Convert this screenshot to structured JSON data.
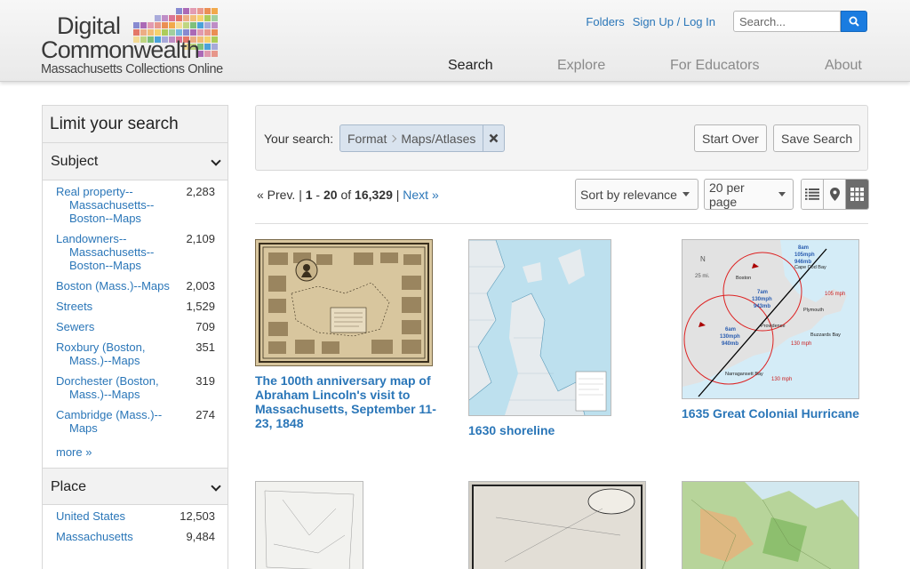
{
  "header": {
    "logo": {
      "line1": "Digital",
      "line2": "Commonwealth",
      "line3": "Massachusetts Collections Online"
    },
    "utility": {
      "folders": "Folders",
      "signup": "Sign Up / Log In",
      "search_placeholder": "Search..."
    },
    "nav": [
      {
        "label": "Search"
      },
      {
        "label": "Explore"
      },
      {
        "label": "For Educators"
      },
      {
        "label": "About"
      }
    ]
  },
  "sidebar": {
    "title": "Limit your search",
    "subject": {
      "heading": "Subject",
      "items": [
        {
          "label": "Real property--Massachusetts--Boston--Maps",
          "count": "2,283"
        },
        {
          "label": "Landowners--Massachusetts--Boston--Maps",
          "count": "2,109"
        },
        {
          "label": "Boston (Mass.)--Maps",
          "count": "2,003"
        },
        {
          "label": "Streets",
          "count": "1,529"
        },
        {
          "label": "Sewers",
          "count": "709"
        },
        {
          "label": "Roxbury (Boston, Mass.)--Maps",
          "count": "351"
        },
        {
          "label": "Dorchester (Boston, Mass.)--Maps",
          "count": "319"
        },
        {
          "label": "Cambridge (Mass.)--Maps",
          "count": "274"
        }
      ],
      "more": "more »"
    },
    "place": {
      "heading": "Place",
      "items": [
        {
          "label": "United States",
          "count": "12,503"
        },
        {
          "label": "Massachusetts",
          "count": "9,484"
        }
      ]
    }
  },
  "constraints": {
    "your_search": "Your search:",
    "filter_field": "Format",
    "filter_value": "Maps/Atlases",
    "start_over": "Start Over",
    "save_search": "Save Search"
  },
  "pager": {
    "prev": "« Prev.",
    "sep": "|",
    "start": "1",
    "dash": "-",
    "end": "20",
    "of": "of",
    "total": "16,329",
    "next": "Next »"
  },
  "sort": {
    "sort_label": "Sort by relevance",
    "per_page_label": "20 per page"
  },
  "results": [
    {
      "title": "The 100th anniversary map of Abraham Lincoln's visit to Massachusetts, September 11-23, 1848"
    },
    {
      "title": "1630 shoreline"
    },
    {
      "title": "1635 Great Colonial Hurricane"
    }
  ],
  "hurricane_map": {
    "north": "N",
    "scale": "25 mi.",
    "labels": [
      "Boston",
      "Plymouth",
      "Providence",
      "Narragansett Bay",
      "Buzzards Bay",
      "Cape Cod Bay"
    ],
    "obs": [
      {
        "time": "8am",
        "speed": "105mph",
        "pressure": "946mb"
      },
      {
        "time": "7am",
        "speed": "130mph",
        "pressure": "943mb"
      },
      {
        "time": "6am",
        "speed": "130mph",
        "pressure": "940mb"
      }
    ],
    "speeds": [
      "105 mph",
      "130 mph",
      "130 mph"
    ]
  },
  "colors": {
    "link": "#2a76b8",
    "search_button": "#1a7ce0",
    "grid_active": "#6c6c6c"
  }
}
